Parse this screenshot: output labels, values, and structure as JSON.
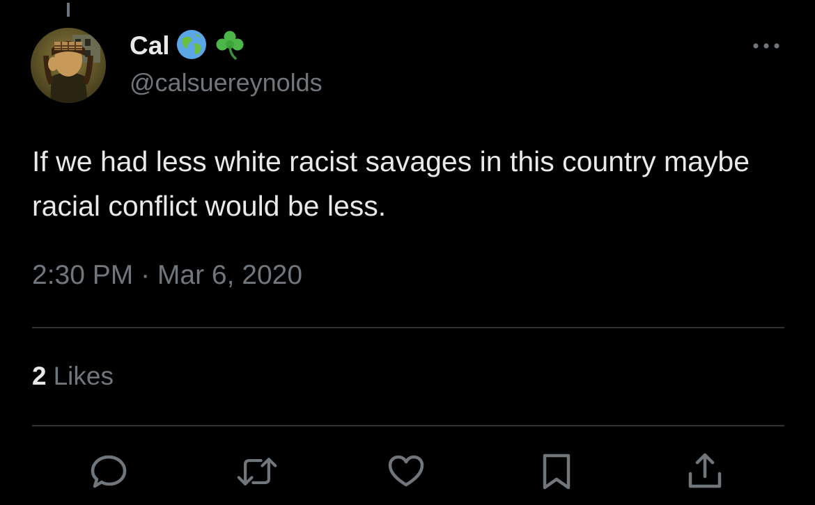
{
  "tweet": {
    "display_name": "Cal",
    "badges": [
      "globe-earth-emoji",
      "shamrock-emoji"
    ],
    "handle": "@calsuereynolds",
    "text": "If we had less white racist savages in this country maybe racial conflict would be less.",
    "timestamp": "2:30 PM · Mar 6, 2020"
  },
  "stats": {
    "likes_count": "2",
    "likes_label": "Likes"
  },
  "actions": [
    "reply-icon",
    "retweet-icon",
    "like-icon",
    "bookmark-icon",
    "share-icon"
  ],
  "colors": {
    "background": "#000000",
    "primary_text": "#e7e9ea",
    "secondary_text": "#71767b",
    "divider": "#2f3336"
  }
}
